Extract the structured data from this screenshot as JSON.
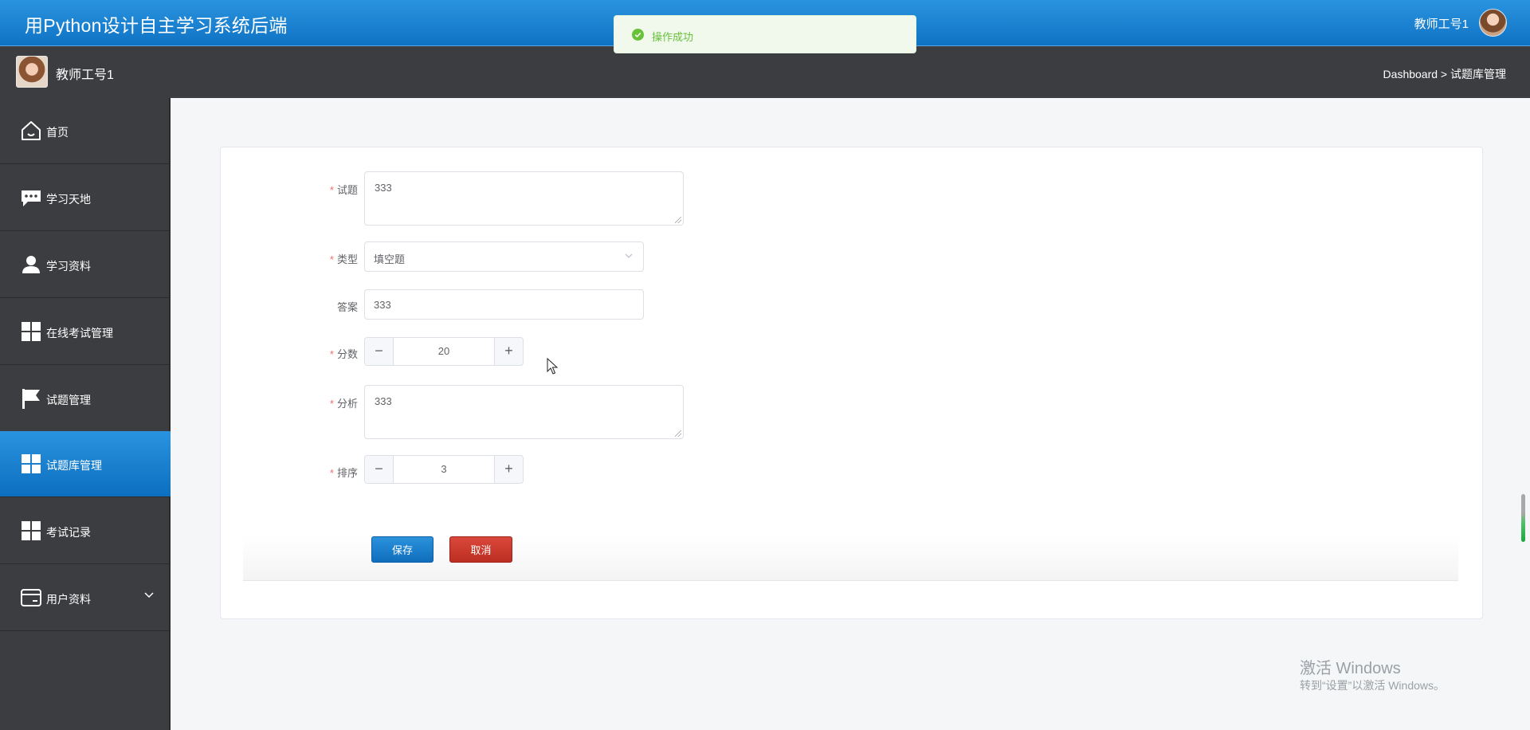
{
  "header": {
    "app_title": "用Python设计自主学习系统后端",
    "user_name": "教师工号1"
  },
  "subbar": {
    "user_name": "教师工号1",
    "breadcrumb": "Dashboard > 试题库管理"
  },
  "toast": {
    "message": "操作成功",
    "color": "#67c23a"
  },
  "sidebar": {
    "items": [
      {
        "label": "首页",
        "icon": "home-icon"
      },
      {
        "label": "学习天地",
        "icon": "chat-bubble-icon"
      },
      {
        "label": "学习资料",
        "icon": "user-icon"
      },
      {
        "label": "在线考试管理",
        "icon": "grid-icon"
      },
      {
        "label": "试题管理",
        "icon": "flag-icon"
      },
      {
        "label": "试题库管理",
        "icon": "grid-icon",
        "active": true
      },
      {
        "label": "考试记录",
        "icon": "grid-icon"
      },
      {
        "label": "用户资料",
        "icon": "card-icon",
        "expandable": true
      }
    ],
    "active_color": "#1a80d2"
  },
  "form": {
    "question": {
      "label": "试题",
      "value": "333",
      "required": true
    },
    "type": {
      "label": "类型",
      "value": "填空题",
      "required": true
    },
    "answer": {
      "label": "答案",
      "value": "333",
      "required": false
    },
    "score": {
      "label": "分数",
      "value": "20",
      "required": true
    },
    "analysis": {
      "label": "分析",
      "value": "333",
      "required": true
    },
    "order": {
      "label": "排序",
      "value": "3",
      "required": true
    },
    "save_label": "保存",
    "cancel_label": "取消",
    "stepper_minus": "−",
    "stepper_plus": "+",
    "required_mark": "*"
  },
  "watermark": {
    "title": "激活 Windows",
    "subtitle": "转到“设置”以激活 Windows。"
  }
}
